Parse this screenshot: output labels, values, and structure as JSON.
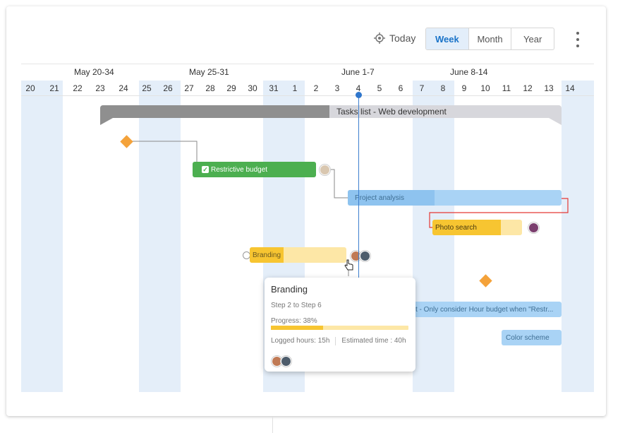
{
  "toolbar": {
    "today_label": "Today",
    "views": [
      "Week",
      "Month",
      "Year"
    ],
    "active_view": "Week"
  },
  "weeks": [
    {
      "label": "May 20-34"
    },
    {
      "label": "May 25-31"
    },
    {
      "label": "June 1-7"
    },
    {
      "label": "June 8-14"
    }
  ],
  "days": [
    "20",
    "21",
    "22",
    "23",
    "24",
    "25",
    "26",
    "27",
    "28",
    "29",
    "30",
    "31",
    "1",
    "2",
    "3",
    "4",
    "5",
    "6",
    "7",
    "8",
    "9",
    "10",
    "11",
    "12",
    "13",
    "14"
  ],
  "group": {
    "label": "Tasks list - Web development"
  },
  "tasks": {
    "restrictive_budget": "Restrictive budget",
    "project_analysis": "Project analysis",
    "photo_search": "Photo search",
    "branding": "Branding",
    "hour_budget": "t - Only consider Hour budget when \"Restr...",
    "color_scheme": "Color scheme"
  },
  "tooltip": {
    "title": "Branding",
    "steps": "Step 2 to Step 6",
    "progress_label": "Progress: 38%",
    "progress": 0.38,
    "logged": "Logged hours: 15h",
    "estimated": "Estimated time : 40h"
  },
  "colors": {
    "accent": "#1a73c8",
    "weekend": "#e4eef9",
    "green": "#4caf50",
    "blue_bar": "#a9d3f5",
    "yellow": "#f7c531",
    "yellow_light": "#fde7a6",
    "milestone": "#f4a23a",
    "dependency_critical": "#e53935"
  }
}
